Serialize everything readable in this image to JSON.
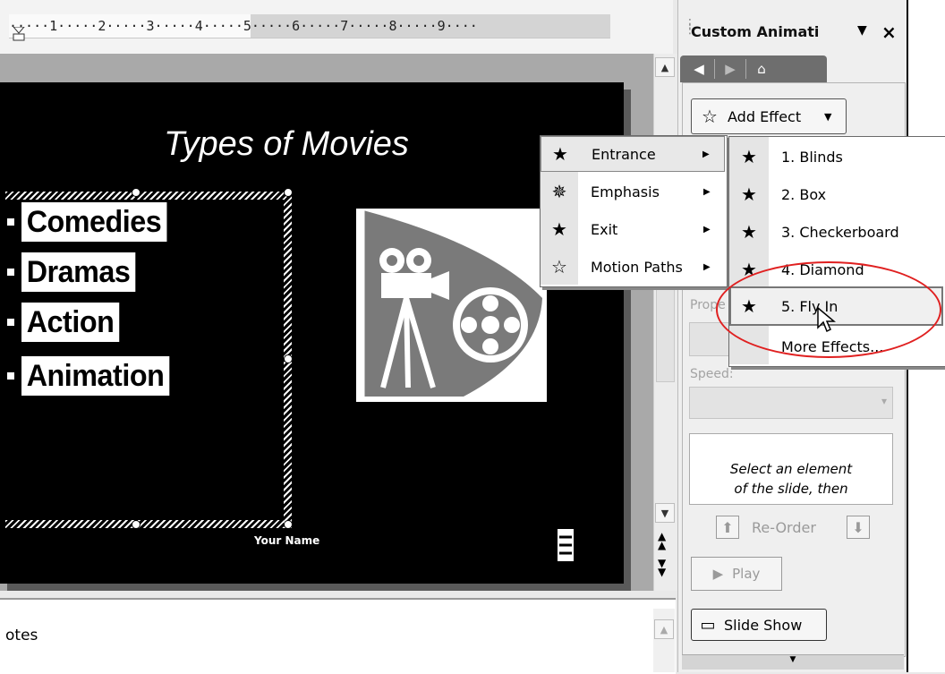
{
  "ruler": {
    "numbers": "·····1·····2·····3·····4·····5·····6·····7·····8·····9····"
  },
  "slide": {
    "title": "Types of Movies",
    "bullets": [
      "Comedies",
      "Dramas",
      "Action",
      "Animation"
    ],
    "footer": "Your Name"
  },
  "notes": {
    "label": "otes"
  },
  "task_pane": {
    "title": "Custom Animati",
    "dropdown_icon": "▼",
    "close_icon": "×",
    "nav_icons": [
      "back-icon",
      "forward-icon",
      "home-icon"
    ],
    "add_effect_label": "Add Effect",
    "property_label": "Prope",
    "speed_label": "Speed:",
    "instruction_lines": [
      "Select an element",
      "of the slide, then"
    ],
    "reorder_label": "Re-Order",
    "play_label": "Play",
    "slideshow_label": "Slide Show"
  },
  "add_effect_menu": {
    "items": [
      {
        "label": "Entrance",
        "icon": "entrance-star-icon"
      },
      {
        "label": "Emphasis",
        "icon": "emphasis-star-icon"
      },
      {
        "label": "Exit",
        "icon": "exit-star-icon"
      },
      {
        "label": "Motion Paths",
        "icon": "motion-path-star-icon"
      }
    ]
  },
  "entrance_submenu": {
    "items": [
      {
        "label": "1. Blinds",
        "icon": "blinds-icon"
      },
      {
        "label": "2. Box",
        "icon": "box-icon"
      },
      {
        "label": "3. Checkerboard",
        "icon": "checkerboard-icon"
      },
      {
        "label": "4. Diamond",
        "icon": "diamond-icon"
      },
      {
        "label": "5. Fly In",
        "icon": "fly-in-icon"
      }
    ],
    "more_label": "More Effects...",
    "highlighted": "5. Fly In"
  },
  "colors": {
    "annotation_ring": "#e02020",
    "slide_background": "#000000",
    "clipart_gray": "#7a7a7a"
  }
}
